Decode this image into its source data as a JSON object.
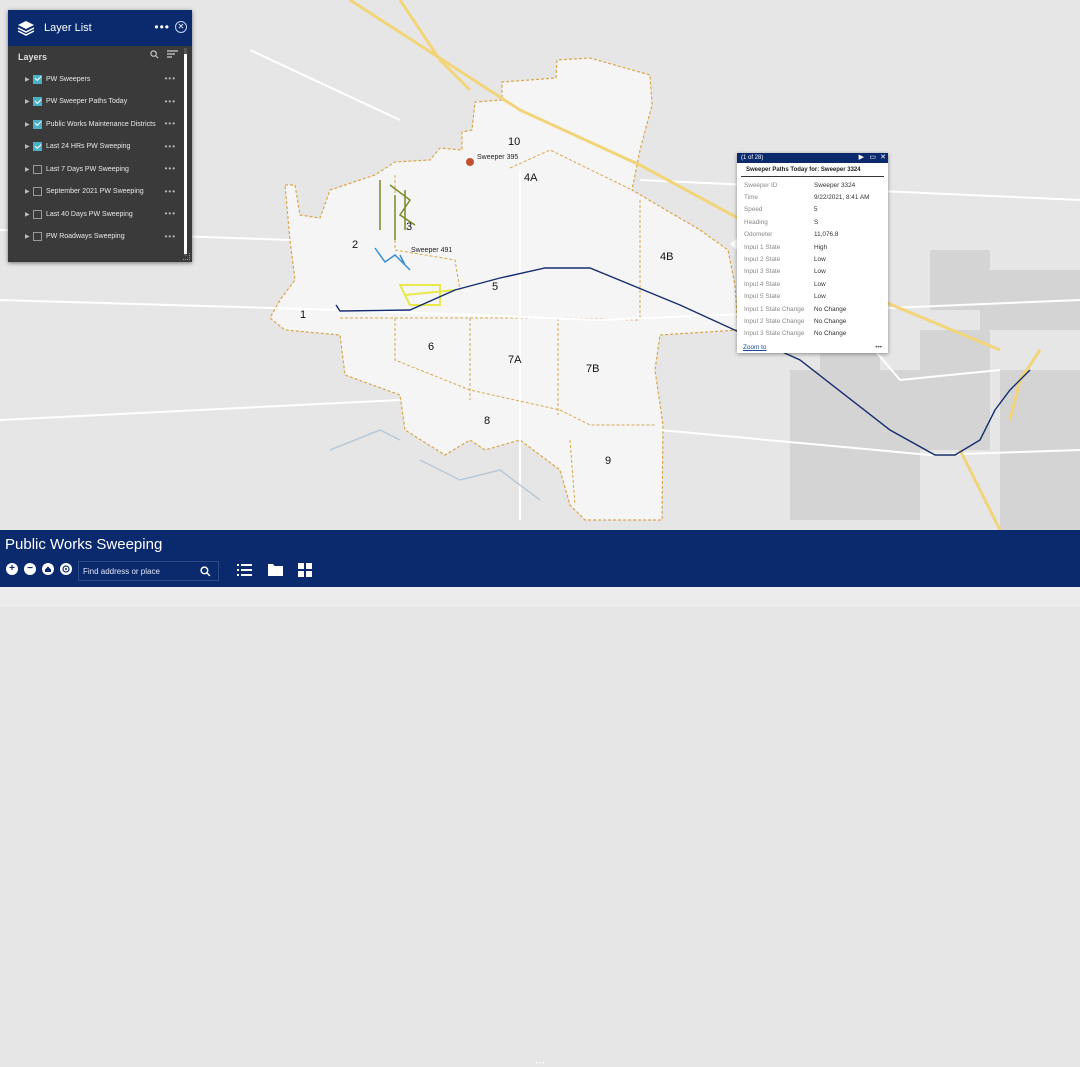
{
  "app": {
    "title": "Public Works Sweeping"
  },
  "layer_list": {
    "title": "Layer List",
    "section_label": "Layers",
    "items": [
      {
        "label": "PW Sweepers",
        "checked": true
      },
      {
        "label": "PW Sweeper Paths Today",
        "checked": true
      },
      {
        "label": "Public Works Maintenance Districts",
        "checked": true
      },
      {
        "label": "Last 24 HRs PW Sweeping",
        "checked": true
      },
      {
        "label": "Last 7 Days PW Sweeping",
        "checked": false
      },
      {
        "label": "September 2021 PW Sweeping",
        "checked": false
      },
      {
        "label": "Last 40 Days PW Sweeping",
        "checked": false
      },
      {
        "label": "PW Roadways Sweeping",
        "checked": false
      }
    ]
  },
  "popup": {
    "counter": "(1 of 28)",
    "title": "Sweeper Paths Today for: Sweeper 3324",
    "attributes": [
      {
        "key": "Sweeper ID",
        "value": "Sweeper 3324"
      },
      {
        "key": "Time",
        "value": "9/22/2021, 8:41 AM"
      },
      {
        "key": "Speed",
        "value": "5"
      },
      {
        "key": "Heading",
        "value": "S"
      },
      {
        "key": "Odometer",
        "value": "11,076.8"
      },
      {
        "key": "Input 1 State",
        "value": "High"
      },
      {
        "key": "Input 2 State",
        "value": "Low"
      },
      {
        "key": "Input 3 State",
        "value": "Low"
      },
      {
        "key": "Input 4 State",
        "value": "Low"
      },
      {
        "key": "Input 5 State",
        "value": "Low"
      },
      {
        "key": "Input 1 State Change",
        "value": "No Change"
      },
      {
        "key": "Input 2 State Change",
        "value": "No Change"
      },
      {
        "key": "Input 3 State Change",
        "value": "No Change"
      }
    ],
    "zoom_label": "Zoom to"
  },
  "map": {
    "district_labels": [
      "1",
      "2",
      "3",
      "4A",
      "4B",
      "5",
      "6",
      "7A",
      "7B",
      "8",
      "9",
      "10"
    ],
    "sweeper_labels": [
      "Sweeper 395",
      "Sweeper 491"
    ]
  },
  "search": {
    "placeholder": "Find address or place"
  },
  "colors": {
    "brand": "#0b2a6e",
    "path": "#142e6e",
    "district": "#d9a64a",
    "highway": "#f2d479",
    "check": "#4ab0c8"
  }
}
